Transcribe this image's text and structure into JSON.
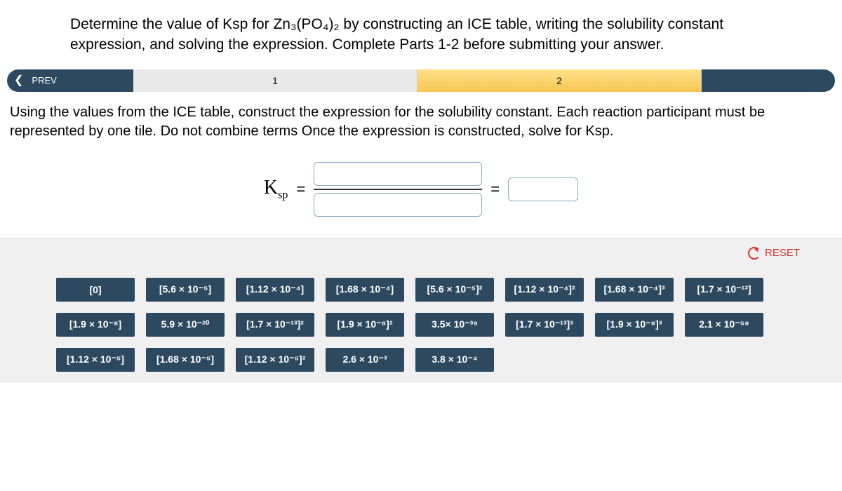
{
  "question": "Determine the value of Ksp for Zn₃(PO₄)₂ by constructing an ICE table, writing the solubility constant expression, and solving the expression. Complete Parts 1-2 before submitting your answer.",
  "nav": {
    "prev_label": "PREV",
    "step1": "1",
    "step2": "2"
  },
  "instructions": "Using the values from the ICE table, construct the expression for the solubility constant. Each reaction participant must be represented by one tile. Do not combine terms  Once the expression is constructed, solve for Ksp.",
  "expression": {
    "ksp_html": "K",
    "ksp_sub": "sp",
    "equals": "="
  },
  "reset_label": "RESET",
  "tiles": [
    [
      "[0]",
      "[5.6 × 10⁻⁵]",
      "[1.12 × 10⁻⁴]",
      "[1.68 × 10⁻⁴]",
      "[5.6 × 10⁻⁵]²",
      "[1.12 × 10⁻⁴]²",
      "[1.68 × 10⁻⁴]³",
      "[1.7 × 10⁻¹³]"
    ],
    [
      "[1.9 × 10⁻⁸]",
      "5.9 × 10⁻²⁰",
      "[1.7 × 10⁻¹³]²",
      "[1.9 × 10⁻⁸]²",
      "3.5× 10⁻³⁹",
      "[1.7 × 10⁻¹³]³",
      "[1.9 × 10⁻⁸]³",
      "2.1 × 10⁻⁵⁸"
    ],
    [
      "[1.12 × 10⁻⁵]",
      "[1.68 × 10⁻⁵]",
      "[1.12 × 10⁻⁵]²",
      "2.6 × 10⁻³",
      "3.8 × 10⁻⁴"
    ]
  ]
}
